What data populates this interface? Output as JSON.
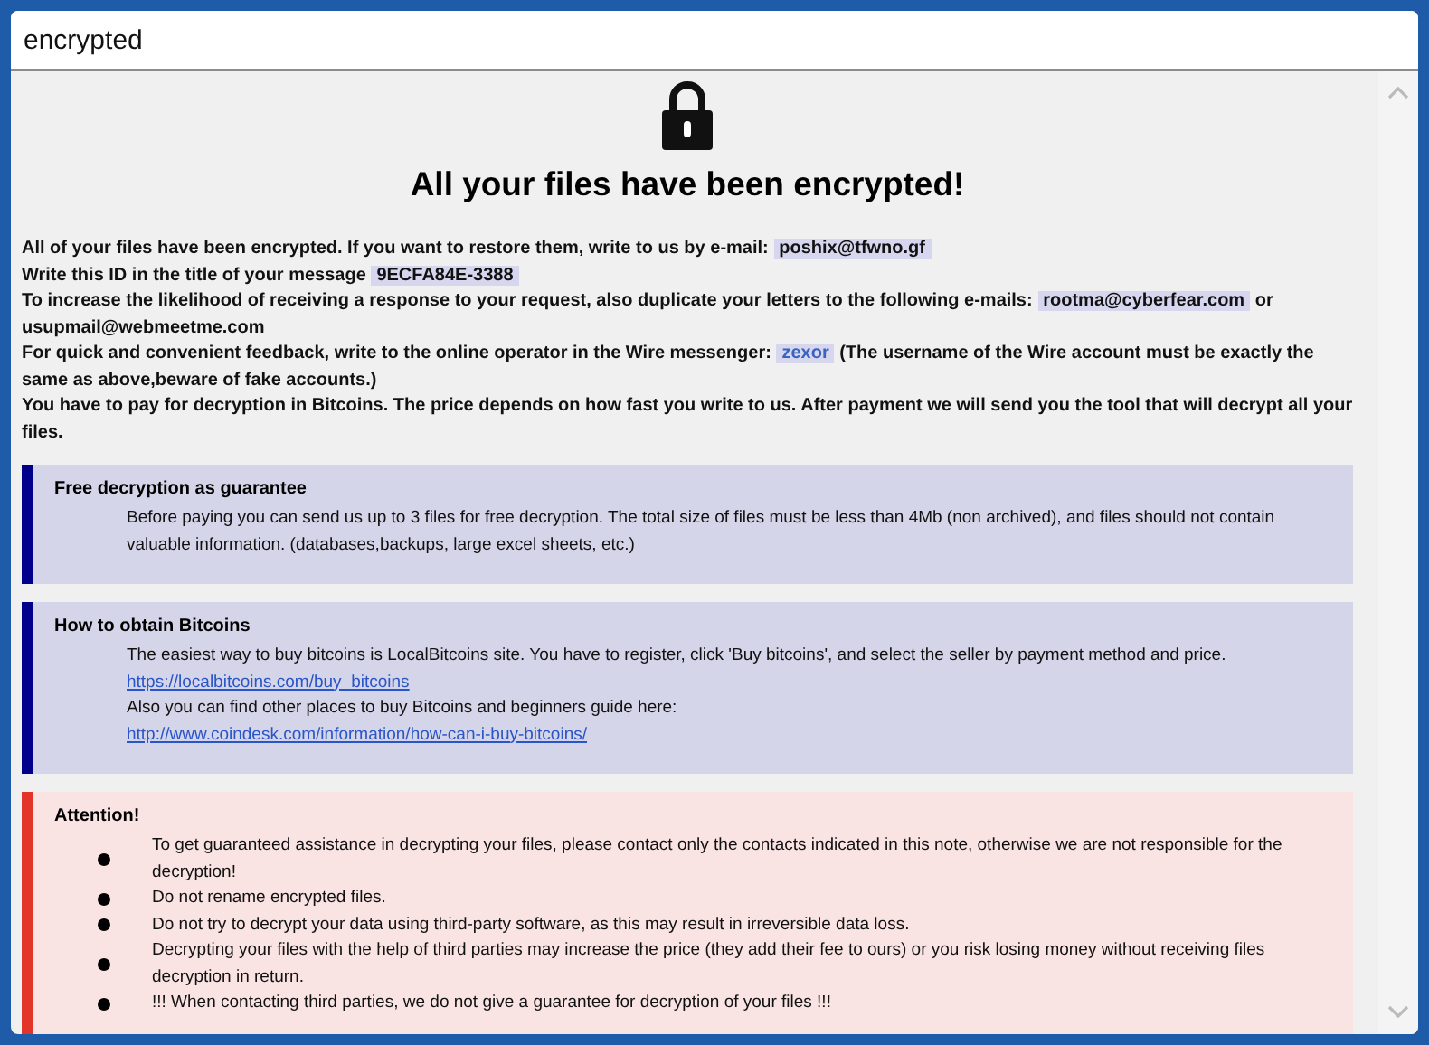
{
  "window": {
    "title": "encrypted"
  },
  "heading": "All your files have been encrypted!",
  "intro": [
    {
      "parts": [
        {
          "kind": "text",
          "text": "All of your files have been encrypted. If you want to restore them, write to us by e-mail: "
        },
        {
          "kind": "tag",
          "text": "poshix@tfwno.gf"
        }
      ]
    },
    {
      "parts": [
        {
          "kind": "text",
          "text": "Write this ID in the title of your message "
        },
        {
          "kind": "tag",
          "text": "9ECFA84E-3388"
        }
      ]
    },
    {
      "parts": [
        {
          "kind": "text",
          "text": "To increase the likelihood of receiving a response to your request, also duplicate your letters to the following e-mails: "
        },
        {
          "kind": "tag",
          "text": "rootma@cyberfear.com"
        },
        {
          "kind": "text",
          "text": " or usupmail@webmeetme.com"
        }
      ]
    },
    {
      "parts": [
        {
          "kind": "text",
          "text": "For quick and convenient feedback, write to the online operator in the Wire messenger: "
        },
        {
          "kind": "link",
          "text": "zexor"
        },
        {
          "kind": "text",
          "text": " (The username of the Wire account must be exactly the same as above,beware of fake accounts.)"
        }
      ]
    },
    {
      "parts": [
        {
          "kind": "text",
          "text": "You have to pay for decryption in Bitcoins. The price depends on how fast you write to us. After payment we will send you the tool that will decrypt all your files."
        }
      ]
    }
  ],
  "sections": [
    {
      "kind": "info",
      "title": "Free decryption as guarantee",
      "lines": [
        {
          "kind": "text",
          "text": "Before paying you can send us up to 3 files for free decryption. The total size of files must be less than 4Mb (non archived), and files should not contain valuable information. (databases,backups, large excel sheets, etc.)"
        }
      ]
    },
    {
      "kind": "info",
      "title": "How to obtain Bitcoins",
      "lines": [
        {
          "kind": "text",
          "text": "The easiest way to buy bitcoins is LocalBitcoins site. You have to register, click 'Buy bitcoins', and select the seller by payment method and price."
        },
        {
          "kind": "link",
          "text": "https://localbitcoins.com/buy_bitcoins"
        },
        {
          "kind": "text",
          "text": "Also you can find other places to buy Bitcoins and beginners guide here:"
        },
        {
          "kind": "link",
          "text": "http://www.coindesk.com/information/how-can-i-buy-bitcoins/"
        }
      ]
    },
    {
      "kind": "warning",
      "title": "Attention!",
      "lines": [
        {
          "kind": "bullet",
          "text": "To get guaranteed assistance in decrypting your files, please contact only the contacts indicated in this note, otherwise we are not responsible for the decryption!"
        },
        {
          "kind": "bullet",
          "text": "Do not rename encrypted files."
        },
        {
          "kind": "bullet",
          "text": "Do not try to decrypt your data using third-party software, as this may result in irreversible data loss."
        },
        {
          "kind": "bullet",
          "text": "Decrypting your files with the help of third parties may increase the price (they add their fee to ours) or you risk losing money without receiving files decryption in return."
        },
        {
          "kind": "bullet",
          "text": "!!! When contacting third parties, we do not give a guarantee for decryption of your files !!!"
        }
      ]
    }
  ]
}
